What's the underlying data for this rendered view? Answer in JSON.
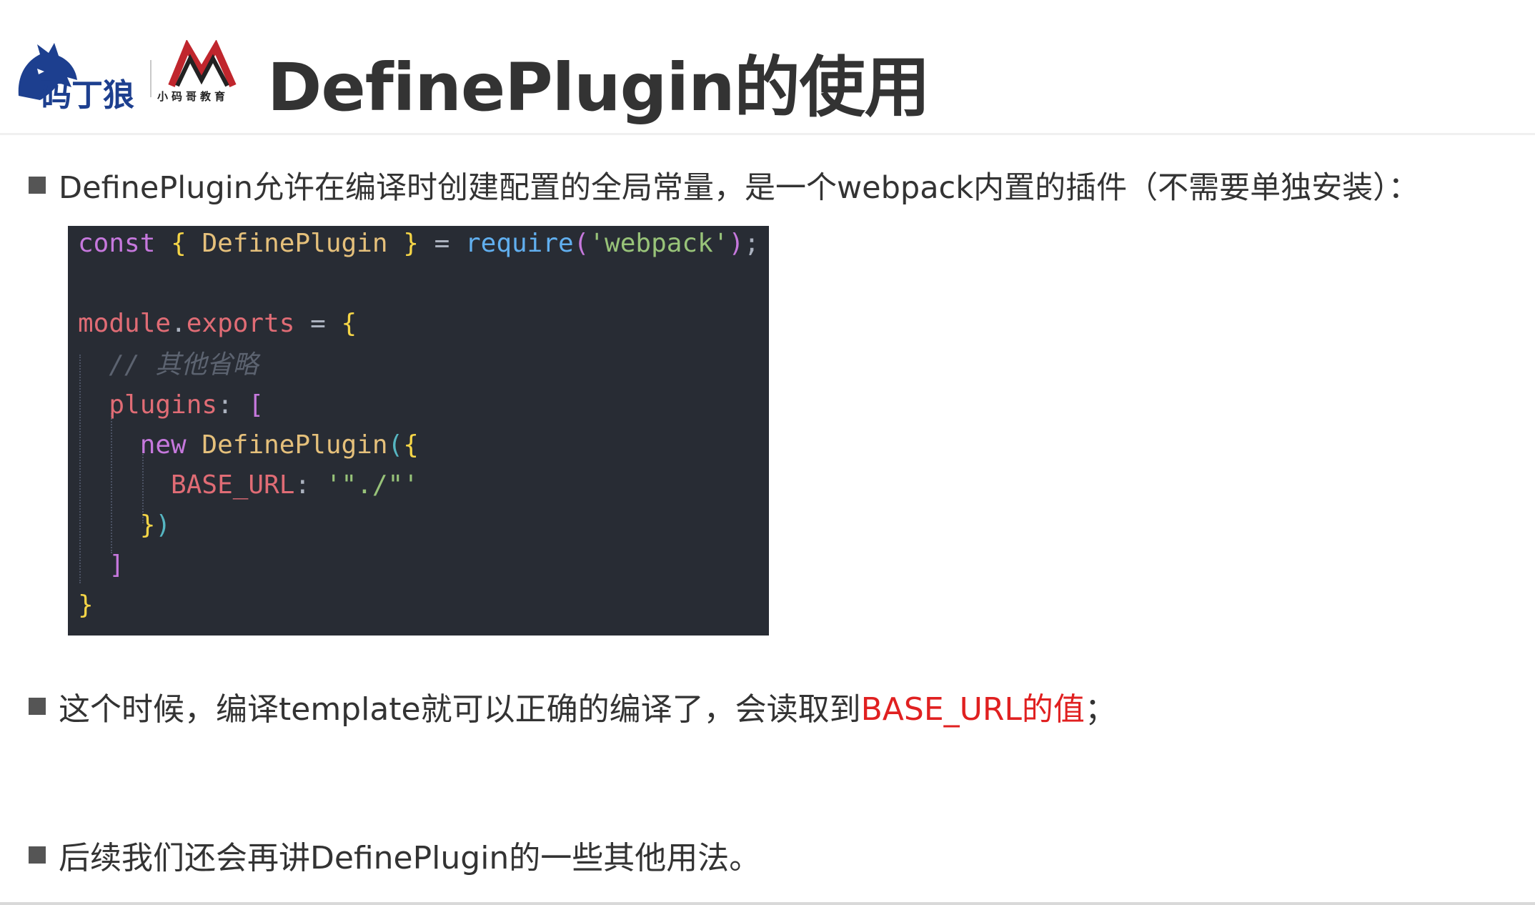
{
  "header": {
    "logo_wolf_text": "码丁狼",
    "logo_m_text": "小码哥教育",
    "title": "DefinePlugin的使用"
  },
  "bullets": [
    {
      "text": "DefinePlugin允许在编译时创建配置的全局常量，是一个webpack内置的插件（不需要单独安装）："
    },
    {
      "text_before": "这个时候，编译template就可以正确的编译了，会读取到",
      "highlight": "BASE_URL的值",
      "text_after": "；"
    },
    {
      "text": "后续我们还会再讲DefinePlugin的一些其他用法。"
    }
  ],
  "code": {
    "line1": {
      "kw": "const",
      "brace_open": "{",
      "cls": "DefinePlugin",
      "brace_close": "}",
      "eq": "=",
      "fn": "require",
      "paren_open": "(",
      "str": "'webpack'",
      "paren_close": ")",
      "semi": ";"
    },
    "line3": {
      "obj": "module",
      "dot": ".",
      "prop": "exports",
      "eq": "=",
      "brace": "{"
    },
    "line4": {
      "comment": "// 其他省略"
    },
    "line5": {
      "prop": "plugins",
      "colon": ":",
      "bracket": "["
    },
    "line6": {
      "kw": "new",
      "cls": "DefinePlugin",
      "paren": "(",
      "brace": "{"
    },
    "line7": {
      "prop": "BASE_URL",
      "colon": ":",
      "str": "'\"./\"'"
    },
    "line8": {
      "brace": "}",
      "paren": ")"
    },
    "line9": {
      "bracket": "]"
    },
    "line10": {
      "brace": "}"
    }
  },
  "colors": {
    "accent_red": "#e02020",
    "code_bg": "#282c34",
    "title": "#333333"
  }
}
